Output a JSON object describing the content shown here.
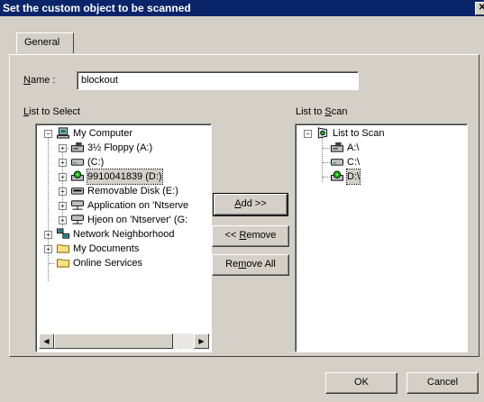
{
  "window": {
    "title": "Set the custom object to be scanned",
    "close_glyph": "✕"
  },
  "tabs": [
    {
      "label": "General"
    }
  ],
  "name_field": {
    "label_prefix": "",
    "label_accel": "N",
    "label_rest": "ame :",
    "value": "blockout"
  },
  "left_list": {
    "label_prefix": "",
    "label_accel": "L",
    "label_rest": "ist to Select",
    "items": [
      {
        "label": "My Computer",
        "icon": "computer-icon",
        "expander": "−"
      },
      {
        "label": "3½ Floppy (A:)",
        "icon": "floppy-drive-icon",
        "expander": "+"
      },
      {
        "label": "(C:)",
        "icon": "hard-drive-icon",
        "expander": "+"
      },
      {
        "label": "9910041839 (D:)",
        "icon": "cd-drive-icon",
        "expander": "+",
        "selected": true
      },
      {
        "label": "Removable Disk (E:)",
        "icon": "removable-disk-icon",
        "expander": "+"
      },
      {
        "label": "Application on 'Ntserve",
        "icon": "network-drive-icon",
        "expander": "+"
      },
      {
        "label": "Hjeon on 'Ntserver' (G:",
        "icon": "network-drive-icon",
        "expander": "+"
      },
      {
        "label": "Network Neighborhood",
        "icon": "network-neighborhood-icon",
        "expander": "+"
      },
      {
        "label": "My Documents",
        "icon": "folder-icon",
        "expander": "+"
      },
      {
        "label": "Online Services",
        "icon": "folder-icon",
        "expander": ""
      }
    ]
  },
  "right_list": {
    "label_prefix": "List to ",
    "label_accel": "S",
    "label_rest": "can",
    "items": [
      {
        "label": "List to Scan",
        "icon": "scan-list-icon",
        "expander": "−"
      },
      {
        "label": "A:\\",
        "icon": "floppy-drive-icon"
      },
      {
        "label": "C:\\",
        "icon": "hard-drive-icon"
      },
      {
        "label": "D:\\",
        "icon": "cd-drive-icon",
        "selected": true
      }
    ]
  },
  "buttons": {
    "add": {
      "prefix": "",
      "accel": "A",
      "rest": "dd >>"
    },
    "remove": {
      "prefix": "<< ",
      "accel": "R",
      "rest": "emove"
    },
    "remove_all": {
      "prefix": "Re",
      "accel": "m",
      "rest": "ove All"
    },
    "ok": "OK",
    "cancel": "Cancel"
  },
  "scrollbar": {
    "left_arrow": "◀",
    "right_arrow": "▶"
  }
}
